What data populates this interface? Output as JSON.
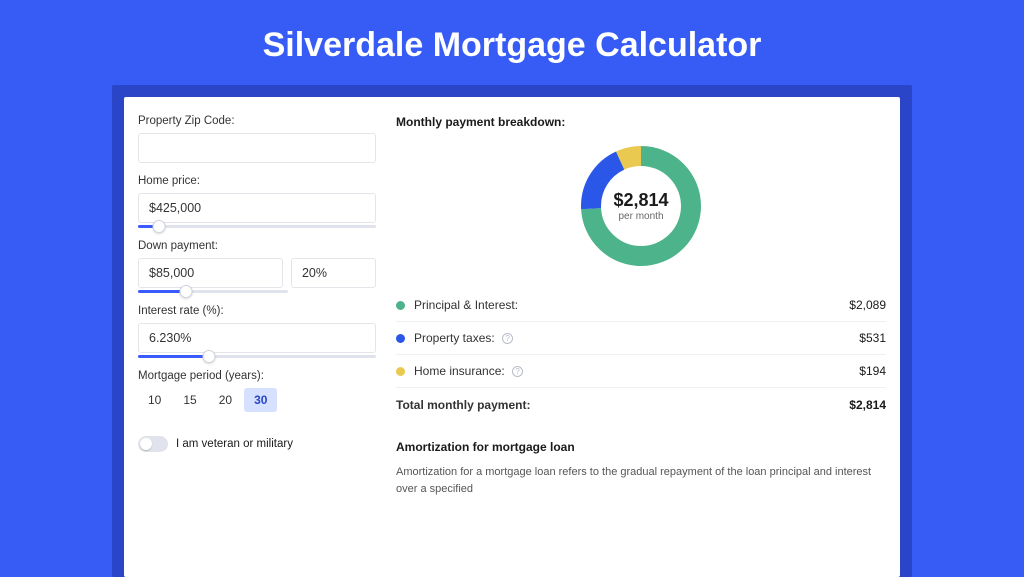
{
  "title": "Silverdale Mortgage Calculator",
  "form": {
    "zip_label": "Property Zip Code:",
    "zip_value": "",
    "home_price_label": "Home price:",
    "home_price_value": "$425,000",
    "home_price_slider_pct": 9,
    "down_payment_label": "Down payment:",
    "down_payment_value": "$85,000",
    "down_payment_pct": "20%",
    "down_payment_slider_pct": 20,
    "interest_label": "Interest rate (%):",
    "interest_value": "6.230%",
    "interest_slider_pct": 30,
    "period_label": "Mortgage period (years):",
    "periods": [
      "10",
      "15",
      "20",
      "30"
    ],
    "period_active": "30",
    "veteran_label": "I am veteran or military"
  },
  "breakdown": {
    "title": "Monthly payment breakdown:",
    "total_big": "$2,814",
    "total_sub": "per month",
    "legend": [
      {
        "label": "Principal & Interest:",
        "value": "$2,089",
        "color": "#4cb38a",
        "info": false,
        "pct": 74
      },
      {
        "label": "Property taxes:",
        "value": "$531",
        "color": "#2a57e8",
        "info": true,
        "pct": 19
      },
      {
        "label": "Home insurance:",
        "value": "$194",
        "color": "#e9c94f",
        "info": true,
        "pct": 7
      }
    ],
    "total_label": "Total monthly payment:",
    "total_value": "$2,814"
  },
  "amortization": {
    "title": "Amortization for mortgage loan",
    "text": "Amortization for a mortgage loan refers to the gradual repayment of the loan principal and interest over a specified"
  },
  "chart_data": {
    "type": "pie",
    "title": "Monthly payment breakdown",
    "series": [
      {
        "name": "Principal & Interest",
        "value": 2089,
        "color": "#4cb38a"
      },
      {
        "name": "Property taxes",
        "value": 531,
        "color": "#2a57e8"
      },
      {
        "name": "Home insurance",
        "value": 194,
        "color": "#e9c94f"
      }
    ],
    "total": 2814,
    "center_label": "$2,814 per month"
  }
}
